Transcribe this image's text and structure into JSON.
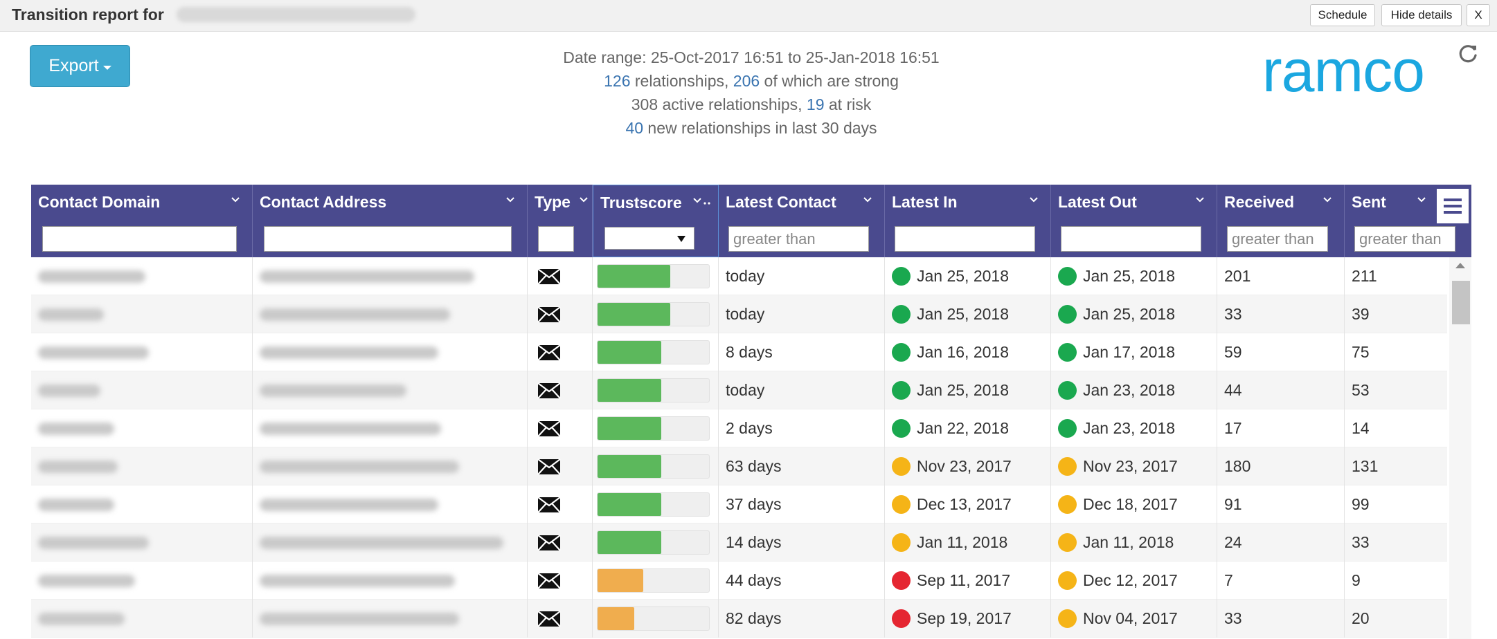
{
  "window": {
    "title": "Transition report for",
    "schedule_label": "Schedule",
    "hide_details_label": "Hide details",
    "close_label": "X"
  },
  "toolbar": {
    "export_label": "Export"
  },
  "summary": {
    "date_range": "Date range: 25-Oct-2017 16:51 to 25-Jan-2018 16:51",
    "relationships_count": "126",
    "relationships_text": " relationships, ",
    "strong_count": "206",
    "strong_text": " of which are strong",
    "active_text": "308 active relationships, ",
    "at_risk_count": "19",
    "at_risk_text": " at risk",
    "new_count": "40",
    "new_text": " new relationships in last 30 days"
  },
  "logo": {
    "text": "ramco",
    "color": "#1ba7e0"
  },
  "colors": {
    "header": "#4a4a8e",
    "green": "#5cb85c",
    "orange": "#f0ad4e",
    "dot_green": "#1aa84f",
    "dot_orange": "#f5b417",
    "dot_red": "#e52631"
  },
  "grid": {
    "columns": [
      {
        "key": "domain",
        "label": "Contact Domain",
        "filter_placeholder": ""
      },
      {
        "key": "address",
        "label": "Contact Address",
        "filter_placeholder": ""
      },
      {
        "key": "type",
        "label": "Type",
        "filter_placeholder": ""
      },
      {
        "key": "trustscore",
        "label": "Trustscore",
        "filter_placeholder": ""
      },
      {
        "key": "latest_contact",
        "label": "Latest Contact",
        "filter_placeholder": "greater than"
      },
      {
        "key": "latest_in",
        "label": "Latest In",
        "filter_placeholder": ""
      },
      {
        "key": "latest_out",
        "label": "Latest Out",
        "filter_placeholder": ""
      },
      {
        "key": "received",
        "label": "Received",
        "filter_placeholder": "greater than"
      },
      {
        "key": "sent",
        "label": "Sent",
        "filter_placeholder": "greater than"
      }
    ],
    "rows": [
      {
        "type_icon": "envelope-icon",
        "trust": 0.65,
        "trust_color": "green",
        "latest_contact": "today",
        "latest_in": "Jan 25, 2018",
        "in_status": "green",
        "latest_out": "Jan 25, 2018",
        "out_status": "green",
        "received": "201",
        "sent": "211"
      },
      {
        "type_icon": "envelope-icon",
        "trust": 0.65,
        "trust_color": "green",
        "latest_contact": "today",
        "latest_in": "Jan 25, 2018",
        "in_status": "green",
        "latest_out": "Jan 25, 2018",
        "out_status": "green",
        "received": "33",
        "sent": "39"
      },
      {
        "type_icon": "envelope-icon",
        "trust": 0.57,
        "trust_color": "green",
        "latest_contact": "8 days",
        "latest_in": "Jan 16, 2018",
        "in_status": "green",
        "latest_out": "Jan 17, 2018",
        "out_status": "green",
        "received": "59",
        "sent": "75"
      },
      {
        "type_icon": "envelope-icon",
        "trust": 0.57,
        "trust_color": "green",
        "latest_contact": "today",
        "latest_in": "Jan 25, 2018",
        "in_status": "green",
        "latest_out": "Jan 23, 2018",
        "out_status": "green",
        "received": "44",
        "sent": "53"
      },
      {
        "type_icon": "envelope-icon",
        "trust": 0.57,
        "trust_color": "green",
        "latest_contact": "2 days",
        "latest_in": "Jan 22, 2018",
        "in_status": "green",
        "latest_out": "Jan 23, 2018",
        "out_status": "green",
        "received": "17",
        "sent": "14"
      },
      {
        "type_icon": "envelope-icon",
        "trust": 0.57,
        "trust_color": "green",
        "latest_contact": "63 days",
        "latest_in": "Nov 23, 2017",
        "in_status": "orange",
        "latest_out": "Nov 23, 2017",
        "out_status": "orange",
        "received": "180",
        "sent": "131"
      },
      {
        "type_icon": "envelope-icon",
        "trust": 0.57,
        "trust_color": "green",
        "latest_contact": "37 days",
        "latest_in": "Dec 13, 2017",
        "in_status": "orange",
        "latest_out": "Dec 18, 2017",
        "out_status": "orange",
        "received": "91",
        "sent": "99"
      },
      {
        "type_icon": "envelope-icon",
        "trust": 0.57,
        "trust_color": "green",
        "latest_contact": "14 days",
        "latest_in": "Jan 11, 2018",
        "in_status": "orange",
        "latest_out": "Jan 11, 2018",
        "out_status": "orange",
        "received": "24",
        "sent": "33"
      },
      {
        "type_icon": "envelope-icon",
        "trust": 0.41,
        "trust_color": "orange",
        "latest_contact": "44 days",
        "latest_in": "Sep 11, 2017",
        "in_status": "red",
        "latest_out": "Dec 12, 2017",
        "out_status": "orange",
        "received": "7",
        "sent": "9"
      },
      {
        "type_icon": "envelope-icon",
        "trust": 0.33,
        "trust_color": "orange",
        "latest_contact": "82 days",
        "latest_in": "Sep 19, 2017",
        "in_status": "red",
        "latest_out": "Nov 04, 2017",
        "out_status": "orange",
        "received": "33",
        "sent": "20"
      }
    ]
  }
}
